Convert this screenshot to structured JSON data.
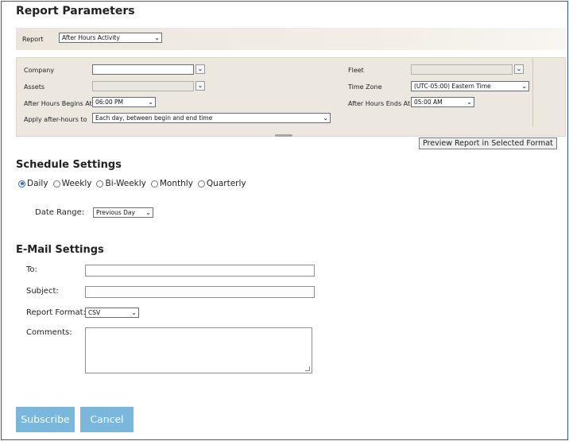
{
  "report_parameters": {
    "title": "Report Parameters",
    "report_label": "Report",
    "report_value": "After Hours Activity",
    "company_label": "Company",
    "company_value": "",
    "fleet_label": "Fleet",
    "fleet_value": "",
    "assets_label": "Assets",
    "assets_value": "",
    "timezone_label": "Time Zone",
    "timezone_value": "(UTC-05:00) Eastern Time",
    "begins_label": "After Hours Begins At",
    "begins_value": "06:00 PM",
    "ends_label": "After Hours Ends At",
    "ends_value": "05:00 AM",
    "apply_label": "Apply after-hours to",
    "apply_value": "Each day, between begin and end time",
    "preview_button": "Preview Report in Selected Format"
  },
  "schedule": {
    "title": "Schedule Settings",
    "options": [
      {
        "label": "Daily",
        "selected": true
      },
      {
        "label": "Weekly",
        "selected": false
      },
      {
        "label": "Bi-Weekly",
        "selected": false
      },
      {
        "label": "Monthly",
        "selected": false
      },
      {
        "label": "Quarterly",
        "selected": false
      }
    ],
    "date_range_label": "Date Range:",
    "date_range_value": "Previous Day"
  },
  "email": {
    "title": "E-Mail Settings",
    "to_label": "To:",
    "to_value": "",
    "subject_label": "Subject:",
    "subject_value": "",
    "format_label": "Report Format:",
    "format_value": "CSV",
    "comments_label": "Comments:",
    "comments_value": ""
  },
  "actions": {
    "subscribe": "Subscribe",
    "cancel": "Cancel"
  },
  "colors": {
    "frame_border": "#2a5fb0",
    "action_button": "#79b8dc",
    "panel_bg": "#ede8df",
    "radio_accent": "#2b6cc4"
  },
  "icons": {
    "dropdown": "chevron-down-icon",
    "resize": "resize-grip-icon"
  }
}
